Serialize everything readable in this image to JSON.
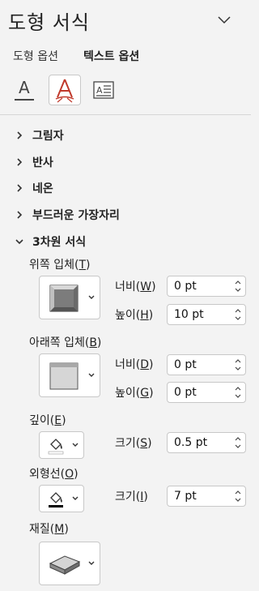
{
  "pane": {
    "title": "도형 서식",
    "tabs": [
      "도형 옵션",
      "텍스트 옵션"
    ],
    "icon_tabs": [
      "text-fill-outline-icon",
      "text-effects-icon",
      "textbox-icon"
    ]
  },
  "sections": {
    "shadow": "그림자",
    "reflection": "반사",
    "glow": "네온",
    "soft_edges": "부드러운 가장자리",
    "format_3d": "3차원 서식"
  },
  "format3d": {
    "top_bevel": {
      "label": "위쪽 입체(",
      "key": "T",
      "end": ")"
    },
    "top_width": {
      "label": "너비(",
      "key": "W",
      "end": ")",
      "value": "0 pt"
    },
    "top_height": {
      "label": "높이(",
      "key": "H",
      "end": ")",
      "value": "10 pt"
    },
    "bottom_bevel": {
      "label": "아래쪽 입체(",
      "key": "B",
      "end": ")"
    },
    "bottom_width": {
      "label": "너비(",
      "key": "D",
      "end": ")",
      "value": "0 pt"
    },
    "bottom_height": {
      "label": "높이(",
      "key": "G",
      "end": ")",
      "value": "0 pt"
    },
    "depth": {
      "label": "깊이(",
      "key": "E",
      "end": ")"
    },
    "depth_size": {
      "label": "크기(",
      "key": "S",
      "end": ")",
      "value": "0.5 pt"
    },
    "contour": {
      "label": "외형선(",
      "key": "O",
      "end": ")"
    },
    "contour_size": {
      "label": "크기(",
      "key": "I",
      "end": ")",
      "value": "7 pt"
    },
    "material": {
      "label": "재질(",
      "key": "M",
      "end": ")"
    }
  }
}
